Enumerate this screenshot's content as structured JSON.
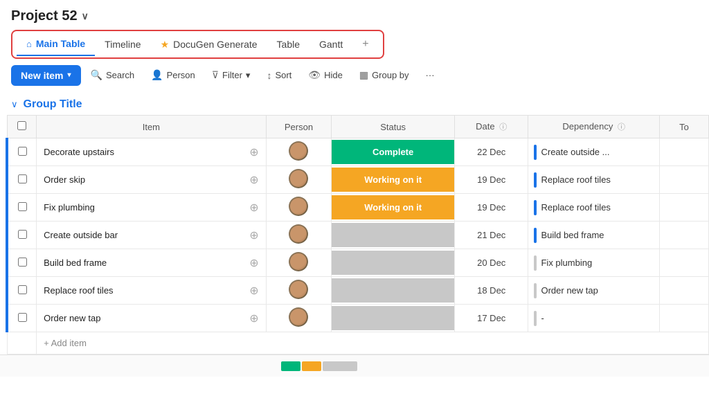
{
  "project": {
    "title": "Project 52",
    "chevron": "∨"
  },
  "tabs": [
    {
      "id": "main-table",
      "label": "Main Table",
      "icon": "⌂",
      "active": true,
      "star": false
    },
    {
      "id": "timeline",
      "label": "Timeline",
      "icon": "",
      "active": false,
      "star": false
    },
    {
      "id": "docugen",
      "label": "DocuGen Generate",
      "icon": "",
      "active": false,
      "star": true
    },
    {
      "id": "table",
      "label": "Table",
      "icon": "",
      "active": false,
      "star": false
    },
    {
      "id": "gantt",
      "label": "Gantt",
      "icon": "",
      "active": false,
      "star": false
    },
    {
      "id": "add",
      "label": "+",
      "icon": "",
      "active": false,
      "star": false
    }
  ],
  "toolbar": {
    "new_item_label": "New item",
    "search_label": "Search",
    "person_label": "Person",
    "filter_label": "Filter",
    "sort_label": "Sort",
    "hide_label": "Hide",
    "group_by_label": "Group by",
    "more_label": "···"
  },
  "group": {
    "title": "Group Title"
  },
  "table": {
    "columns": [
      "Item",
      "Person",
      "Status",
      "Date",
      "Dependency ⓘ",
      "To"
    ],
    "rows": [
      {
        "id": 1,
        "name": "Decorate upstairs",
        "status": "Complete",
        "status_type": "complete",
        "date": "22 Dec",
        "dependency": "Create outside ...",
        "dep_type": "blue"
      },
      {
        "id": 2,
        "name": "Order skip",
        "status": "Working on it",
        "status_type": "working",
        "date": "19 Dec",
        "dependency": "Replace roof tiles",
        "dep_type": "blue"
      },
      {
        "id": 3,
        "name": "Fix plumbing",
        "status": "Working on it",
        "status_type": "working",
        "date": "19 Dec",
        "dependency": "Replace roof tiles",
        "dep_type": "blue"
      },
      {
        "id": 4,
        "name": "Create outside bar",
        "status": "",
        "status_type": "empty",
        "date": "21 Dec",
        "dependency": "Build bed frame",
        "dep_type": "blue"
      },
      {
        "id": 5,
        "name": "Build bed frame",
        "status": "",
        "status_type": "empty",
        "date": "20 Dec",
        "dependency": "Fix plumbing",
        "dep_type": "gray"
      },
      {
        "id": 6,
        "name": "Replace roof tiles",
        "status": "",
        "status_type": "empty",
        "date": "18 Dec",
        "dependency": "Order new tap",
        "dep_type": "gray"
      },
      {
        "id": 7,
        "name": "Order new tap",
        "status": "",
        "status_type": "empty",
        "date": "17 Dec",
        "dependency": "-",
        "dep_type": "gray"
      }
    ],
    "add_item_label": "+ Add item"
  }
}
